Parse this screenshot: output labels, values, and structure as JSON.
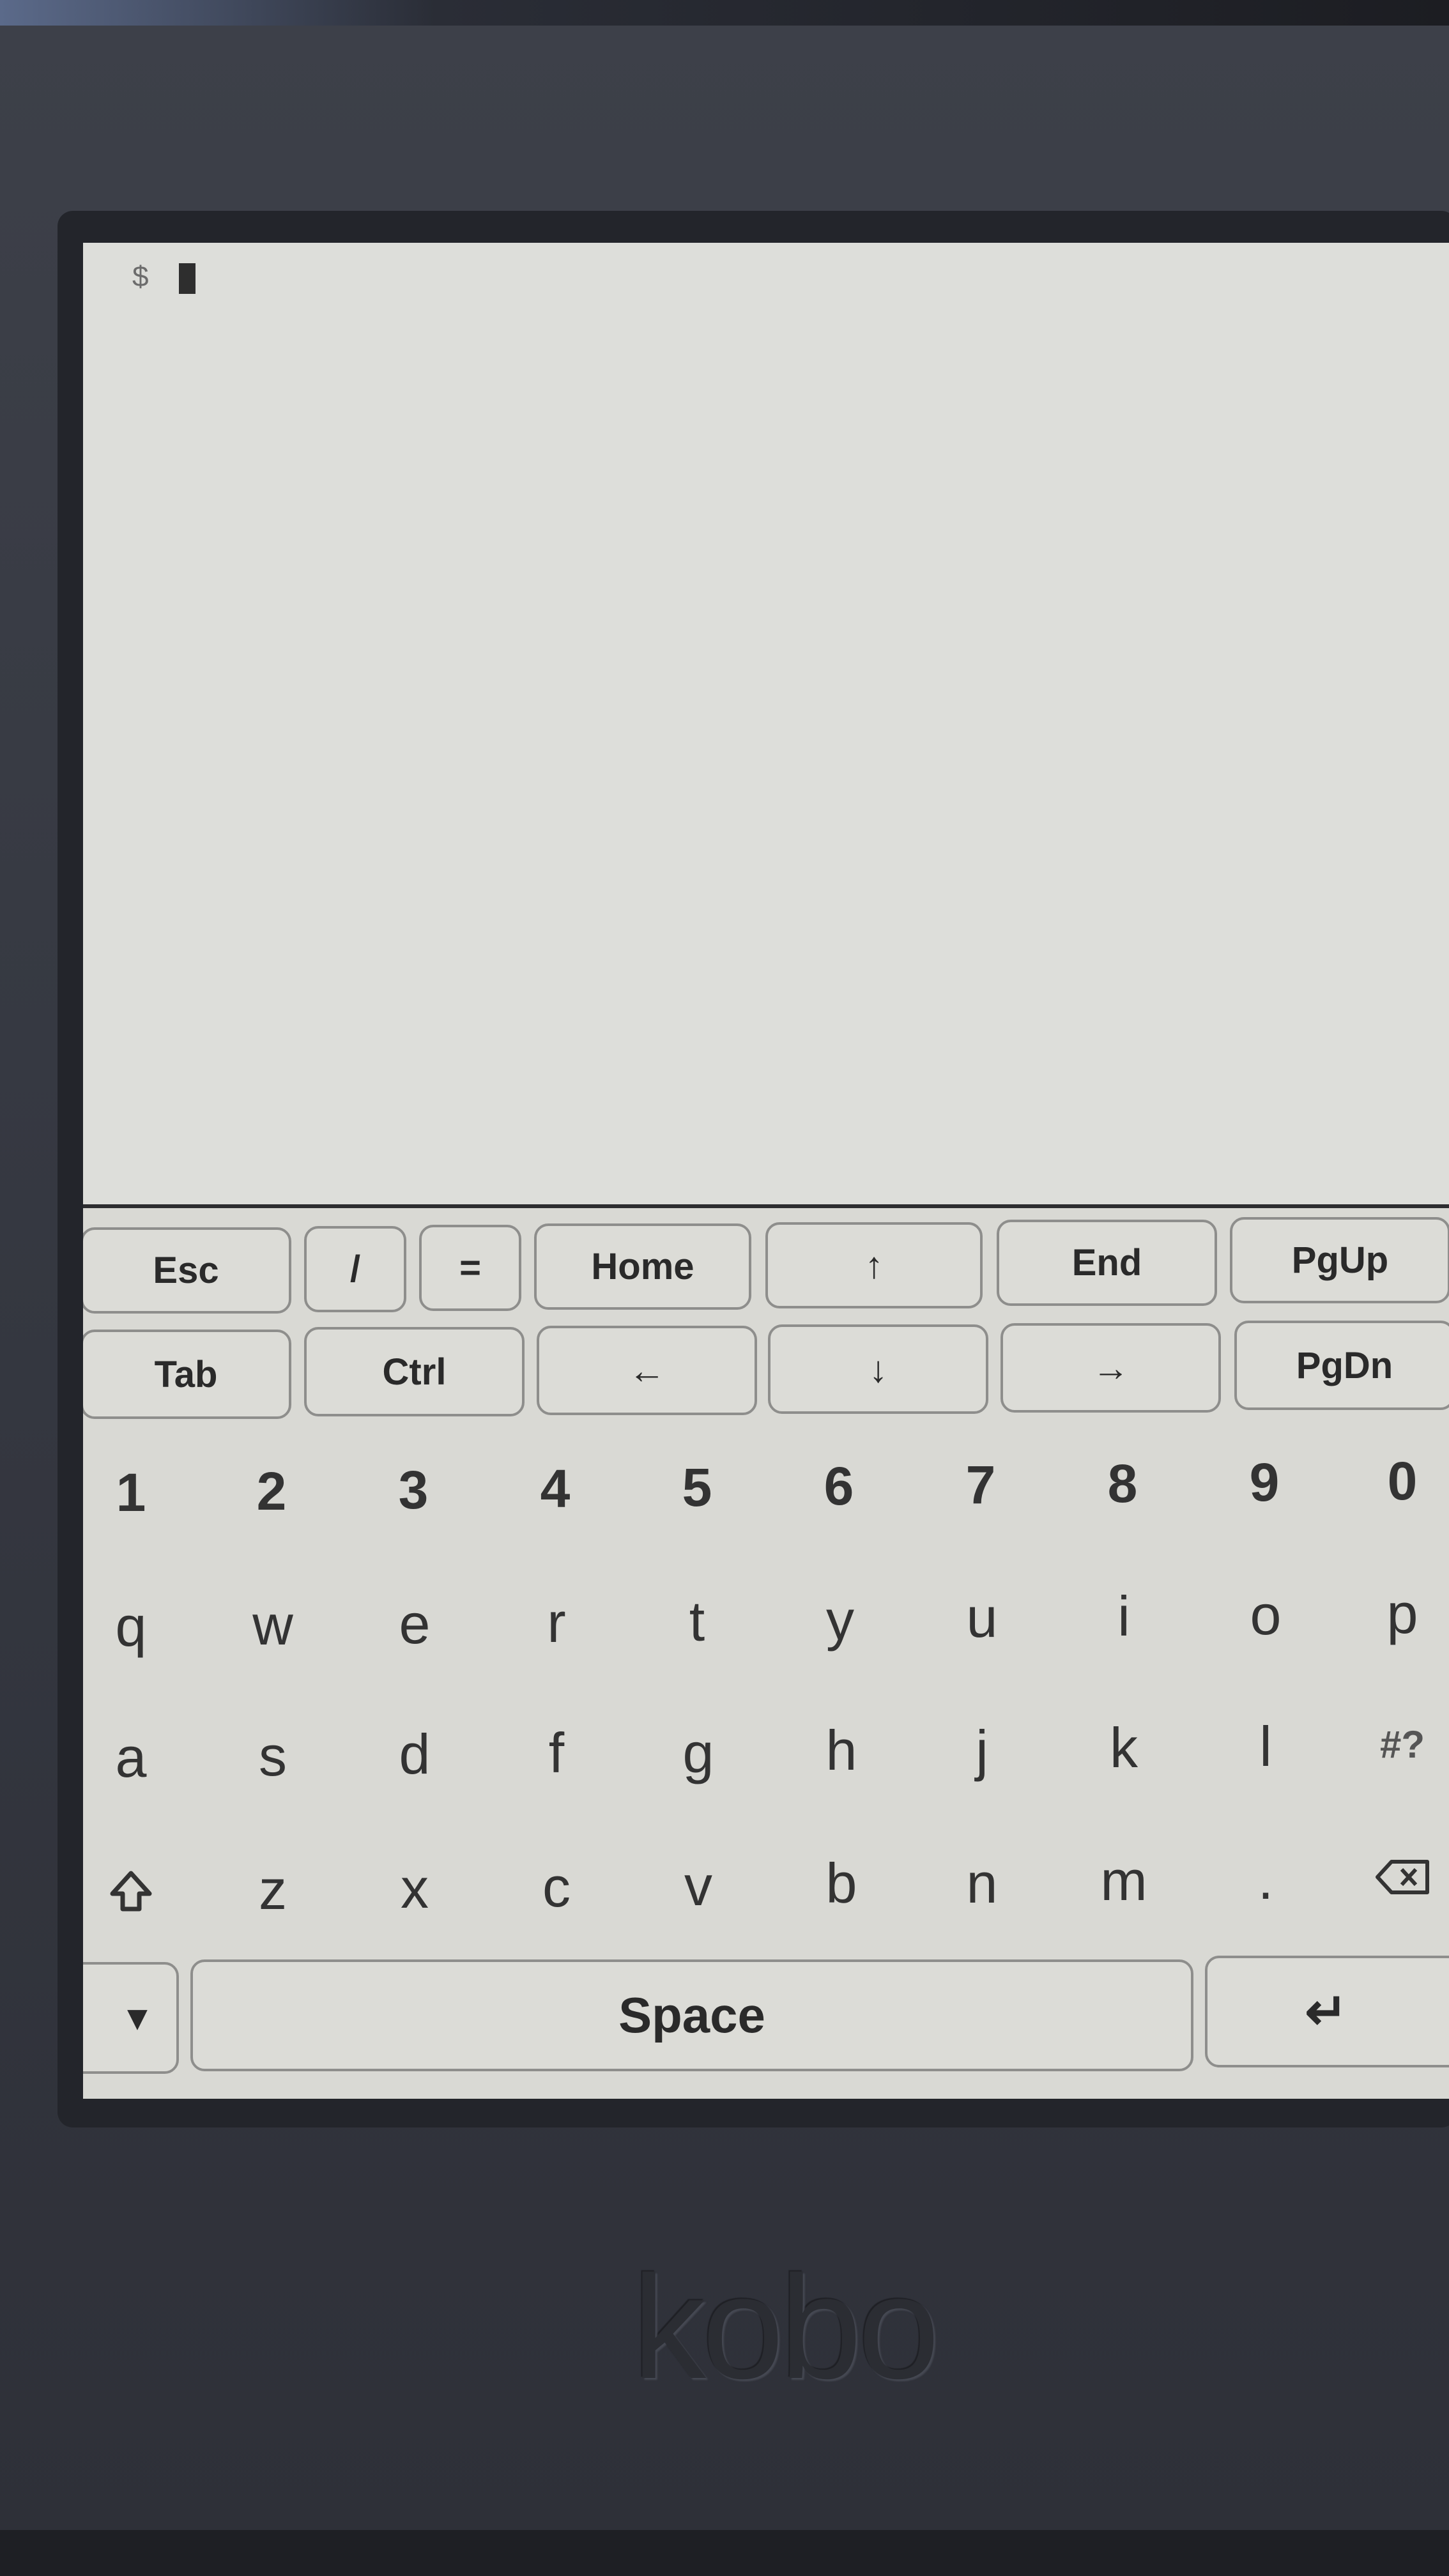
{
  "terminal": {
    "prompt": "$"
  },
  "function_row_1": [
    {
      "label": "Esc"
    },
    {
      "label": "/"
    },
    {
      "label": "="
    },
    {
      "label": "Home"
    },
    {
      "label": "↑"
    },
    {
      "label": "End"
    },
    {
      "label": "PgUp"
    }
  ],
  "function_row_2": [
    {
      "label": "Tab"
    },
    {
      "label": "Ctrl"
    },
    {
      "label": "←"
    },
    {
      "label": "↓"
    },
    {
      "label": "→"
    },
    {
      "label": "PgDn"
    }
  ],
  "number_row": [
    "1",
    "2",
    "3",
    "4",
    "5",
    "6",
    "7",
    "8",
    "9",
    "0"
  ],
  "row_q": [
    "q",
    "w",
    "e",
    "r",
    "t",
    "y",
    "u",
    "i",
    "o",
    "p"
  ],
  "row_a": [
    "a",
    "s",
    "d",
    "f",
    "g",
    "h",
    "j",
    "k",
    "l",
    "#?"
  ],
  "row_z": [
    "z",
    "x",
    "c",
    "v",
    "b",
    "n",
    "m",
    "."
  ],
  "bottom_row": {
    "hide_label": "▼",
    "space_label": "Space",
    "enter_label": "↵"
  },
  "icons": {
    "shift": "shift-arrow-icon",
    "backspace": "backspace-icon"
  },
  "device": {
    "brand": "kobo"
  }
}
